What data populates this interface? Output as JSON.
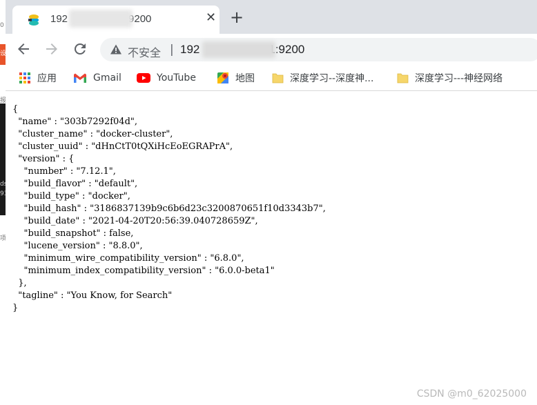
{
  "tab": {
    "title_start": "192",
    "title_end": "9200",
    "favicon": "elastic-icon"
  },
  "toolbar": {
    "security_label": "不安全",
    "divider": "|",
    "url_start": "192",
    "url_end": "1:9200"
  },
  "bookmarks": [
    {
      "label": "应用",
      "icon": "apps-grid-icon"
    },
    {
      "label": "Gmail",
      "icon": "gmail-icon"
    },
    {
      "label": "YouTube",
      "icon": "youtube-icon"
    },
    {
      "label": "地图",
      "icon": "maps-icon"
    },
    {
      "label": "深度学习--深度神...",
      "icon": "folder-icon"
    },
    {
      "label": "深度学习---神经网络",
      "icon": "folder-icon"
    }
  ],
  "json_lines": [
    "{",
    "  \"name\" : \"303b7292f04d\",",
    "  \"cluster_name\" : \"docker-cluster\",",
    "  \"cluster_uuid\" : \"dHnCtT0tQXiHcEoEGRAPrA\",",
    "  \"version\" : {",
    "    \"number\" : \"7.12.1\",",
    "    \"build_flavor\" : \"default\",",
    "    \"build_type\" : \"docker\",",
    "    \"build_hash\" : \"3186837139b9c6b6d23c3200870651f10d3343b7\",",
    "    \"build_date\" : \"2021-04-20T20:56:39.040728659Z\",",
    "    \"build_snapshot\" : false,",
    "    \"lucene_version\" : \"8.8.0\",",
    "    \"minimum_wire_compatibility_version\" : \"6.8.0\",",
    "    \"minimum_index_compatibility_version\" : \"6.0.0-beta1\"",
    "  },",
    "  \"tagline\" : \"You Know, for Search\"",
    "}"
  ],
  "watermark": "CSDN @m0_62025000",
  "left_edge": {
    "chars": [
      "0",
      "设",
      "报",
      "ds",
      "93",
      "项"
    ]
  },
  "colors": {
    "tabstrip": "#dee1e6",
    "omnibox": "#f1f3f4",
    "folder": "#f6d66b",
    "youtube_red": "#ff0000"
  }
}
